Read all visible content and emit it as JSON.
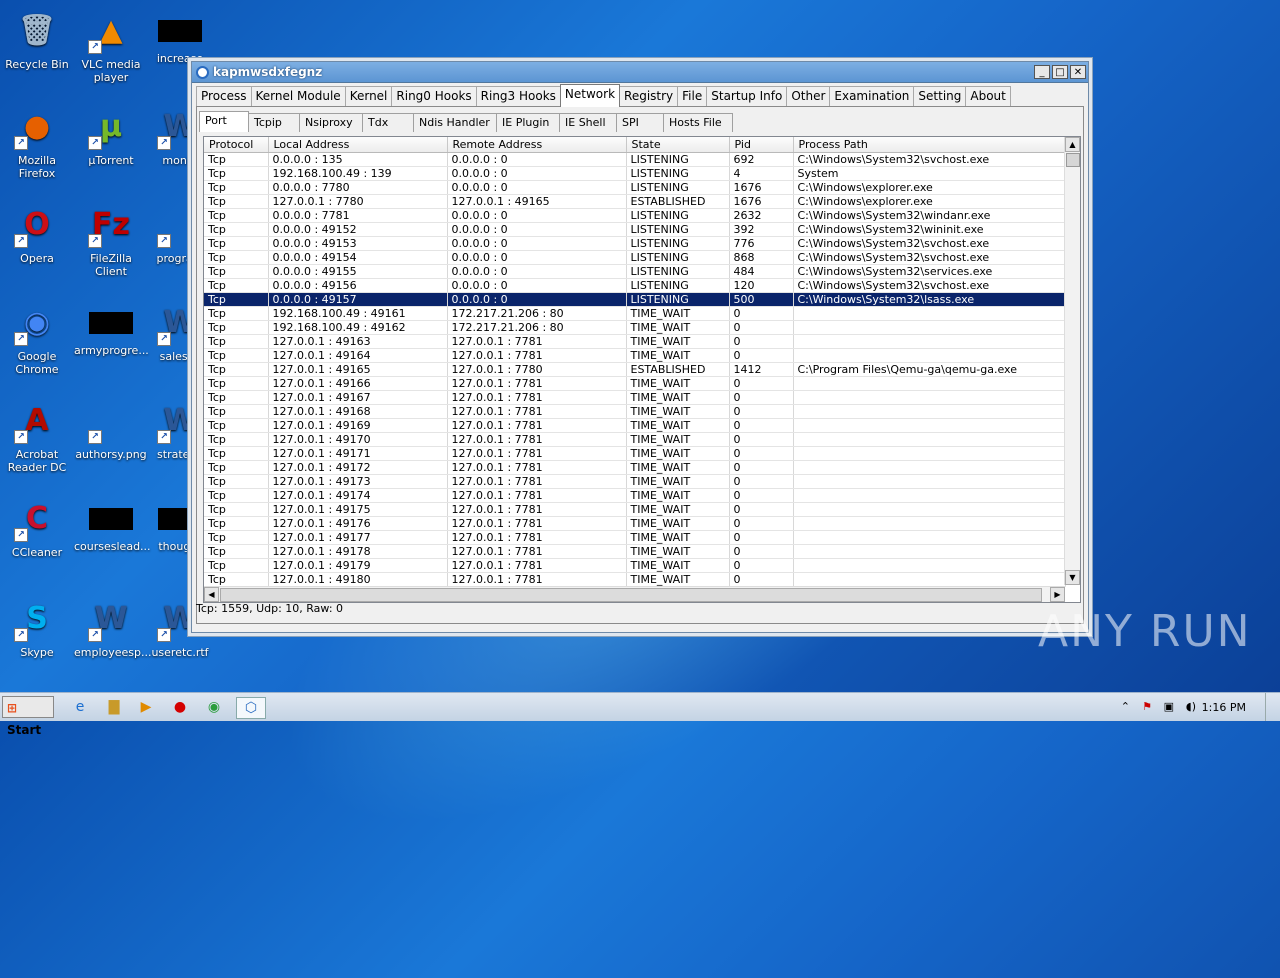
{
  "desktop": {
    "icons": [
      {
        "label": "Recycle Bin"
      },
      {
        "label": "VLC media player"
      },
      {
        "label": "increase"
      },
      {
        "label": "Mozilla Firefox"
      },
      {
        "label": "µTorrent"
      },
      {
        "label": "montv"
      },
      {
        "label": "Opera"
      },
      {
        "label": "FileZilla Client"
      },
      {
        "label": "program"
      },
      {
        "label": "Google Chrome"
      },
      {
        "label": "armyprogre..."
      },
      {
        "label": "salesco"
      },
      {
        "label": "Acrobat Reader DC"
      },
      {
        "label": "authorsy.png"
      },
      {
        "label": "strategy"
      },
      {
        "label": "CCleaner"
      },
      {
        "label": "courseslead..."
      },
      {
        "label": "thought"
      },
      {
        "label": "Skype"
      },
      {
        "label": "employeesp..."
      },
      {
        "label": "useretc.rtf"
      }
    ],
    "watermark": "ANY RUN"
  },
  "window": {
    "title": "kapmwsdxfegnz",
    "main_tabs": [
      "Process",
      "Kernel Module",
      "Kernel",
      "Ring0 Hooks",
      "Ring3 Hooks",
      "Network",
      "Registry",
      "File",
      "Startup Info",
      "Other",
      "Examination",
      "Setting",
      "About"
    ],
    "active_main_tab": "Network",
    "sub_tabs": [
      "Port",
      "Tcpip",
      "Nsiproxy",
      "Tdx",
      "Ndis Handler",
      "IE Plugin",
      "IE Shell",
      "SPI",
      "Hosts File"
    ],
    "active_sub_tab": "Port",
    "columns": [
      "Protocol",
      "Local Address",
      "Remote Address",
      "State",
      "Pid",
      "Process Path"
    ],
    "rows": [
      [
        "Tcp",
        "0.0.0.0 : 135",
        "0.0.0.0 : 0",
        "LISTENING",
        "692",
        "C:\\Windows\\System32\\svchost.exe"
      ],
      [
        "Tcp",
        "192.168.100.49 : 139",
        "0.0.0.0 : 0",
        "LISTENING",
        "4",
        "System"
      ],
      [
        "Tcp",
        "0.0.0.0 : 7780",
        "0.0.0.0 : 0",
        "LISTENING",
        "1676",
        "C:\\Windows\\explorer.exe"
      ],
      [
        "Tcp",
        "127.0.0.1 : 7780",
        "127.0.0.1 : 49165",
        "ESTABLISHED",
        "1676",
        "C:\\Windows\\explorer.exe"
      ],
      [
        "Tcp",
        "0.0.0.0 : 7781",
        "0.0.0.0 : 0",
        "LISTENING",
        "2632",
        "C:\\Windows\\System32\\windanr.exe"
      ],
      [
        "Tcp",
        "0.0.0.0 : 49152",
        "0.0.0.0 : 0",
        "LISTENING",
        "392",
        "C:\\Windows\\System32\\wininit.exe"
      ],
      [
        "Tcp",
        "0.0.0.0 : 49153",
        "0.0.0.0 : 0",
        "LISTENING",
        "776",
        "C:\\Windows\\System32\\svchost.exe"
      ],
      [
        "Tcp",
        "0.0.0.0 : 49154",
        "0.0.0.0 : 0",
        "LISTENING",
        "868",
        "C:\\Windows\\System32\\svchost.exe"
      ],
      [
        "Tcp",
        "0.0.0.0 : 49155",
        "0.0.0.0 : 0",
        "LISTENING",
        "484",
        "C:\\Windows\\System32\\services.exe"
      ],
      [
        "Tcp",
        "0.0.0.0 : 49156",
        "0.0.0.0 : 0",
        "LISTENING",
        "120",
        "C:\\Windows\\System32\\svchost.exe"
      ],
      [
        "Tcp",
        "0.0.0.0 : 49157",
        "0.0.0.0 : 0",
        "LISTENING",
        "500",
        "C:\\Windows\\System32\\lsass.exe"
      ],
      [
        "Tcp",
        "192.168.100.49 : 49161",
        "172.217.21.206 : 80",
        "TIME_WAIT",
        "0",
        ""
      ],
      [
        "Tcp",
        "192.168.100.49 : 49162",
        "172.217.21.206 : 80",
        "TIME_WAIT",
        "0",
        ""
      ],
      [
        "Tcp",
        "127.0.0.1 : 49163",
        "127.0.0.1 : 7781",
        "TIME_WAIT",
        "0",
        ""
      ],
      [
        "Tcp",
        "127.0.0.1 : 49164",
        "127.0.0.1 : 7781",
        "TIME_WAIT",
        "0",
        ""
      ],
      [
        "Tcp",
        "127.0.0.1 : 49165",
        "127.0.0.1 : 7780",
        "ESTABLISHED",
        "1412",
        "C:\\Program Files\\Qemu-ga\\qemu-ga.exe"
      ],
      [
        "Tcp",
        "127.0.0.1 : 49166",
        "127.0.0.1 : 7781",
        "TIME_WAIT",
        "0",
        ""
      ],
      [
        "Tcp",
        "127.0.0.1 : 49167",
        "127.0.0.1 : 7781",
        "TIME_WAIT",
        "0",
        ""
      ],
      [
        "Tcp",
        "127.0.0.1 : 49168",
        "127.0.0.1 : 7781",
        "TIME_WAIT",
        "0",
        ""
      ],
      [
        "Tcp",
        "127.0.0.1 : 49169",
        "127.0.0.1 : 7781",
        "TIME_WAIT",
        "0",
        ""
      ],
      [
        "Tcp",
        "127.0.0.1 : 49170",
        "127.0.0.1 : 7781",
        "TIME_WAIT",
        "0",
        ""
      ],
      [
        "Tcp",
        "127.0.0.1 : 49171",
        "127.0.0.1 : 7781",
        "TIME_WAIT",
        "0",
        ""
      ],
      [
        "Tcp",
        "127.0.0.1 : 49172",
        "127.0.0.1 : 7781",
        "TIME_WAIT",
        "0",
        ""
      ],
      [
        "Tcp",
        "127.0.0.1 : 49173",
        "127.0.0.1 : 7781",
        "TIME_WAIT",
        "0",
        ""
      ],
      [
        "Tcp",
        "127.0.0.1 : 49174",
        "127.0.0.1 : 7781",
        "TIME_WAIT",
        "0",
        ""
      ],
      [
        "Tcp",
        "127.0.0.1 : 49175",
        "127.0.0.1 : 7781",
        "TIME_WAIT",
        "0",
        ""
      ],
      [
        "Tcp",
        "127.0.0.1 : 49176",
        "127.0.0.1 : 7781",
        "TIME_WAIT",
        "0",
        ""
      ],
      [
        "Tcp",
        "127.0.0.1 : 49177",
        "127.0.0.1 : 7781",
        "TIME_WAIT",
        "0",
        ""
      ],
      [
        "Tcp",
        "127.0.0.1 : 49178",
        "127.0.0.1 : 7781",
        "TIME_WAIT",
        "0",
        ""
      ],
      [
        "Tcp",
        "127.0.0.1 : 49179",
        "127.0.0.1 : 7781",
        "TIME_WAIT",
        "0",
        ""
      ],
      [
        "Tcp",
        "127.0.0.1 : 49180",
        "127.0.0.1 : 7781",
        "TIME_WAIT",
        "0",
        ""
      ]
    ],
    "selected_row": 10,
    "status": "Tcp: 1559, Udp: 10, Raw: 0"
  },
  "taskbar": {
    "start_label": "Start",
    "clock": "1:16 PM"
  },
  "colors": {
    "selection": "#0a246a",
    "titlebar": "#5c95d3"
  }
}
